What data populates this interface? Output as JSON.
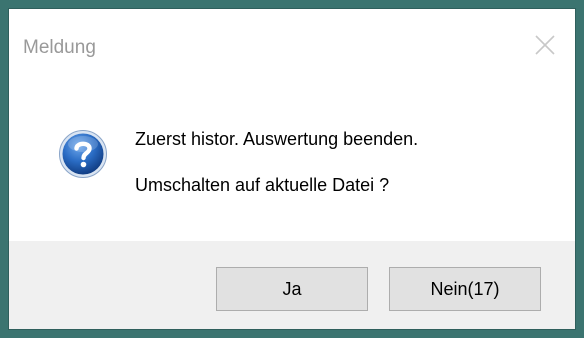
{
  "dialog": {
    "title": "Meldung",
    "close_icon": "close-icon",
    "icon": "question-icon",
    "message_line1": "Zuerst histor. Auswertung beenden.",
    "message_line2": "Umschalten auf aktuelle Datei ?"
  },
  "buttons": {
    "yes_label": "Ja",
    "no_label": "Nein(17)"
  },
  "colors": {
    "desktop_background": "#3b7470",
    "footer_background": "#f0f0f0",
    "button_background": "#e1e1e1",
    "icon_blue": "#1d5fb5"
  }
}
